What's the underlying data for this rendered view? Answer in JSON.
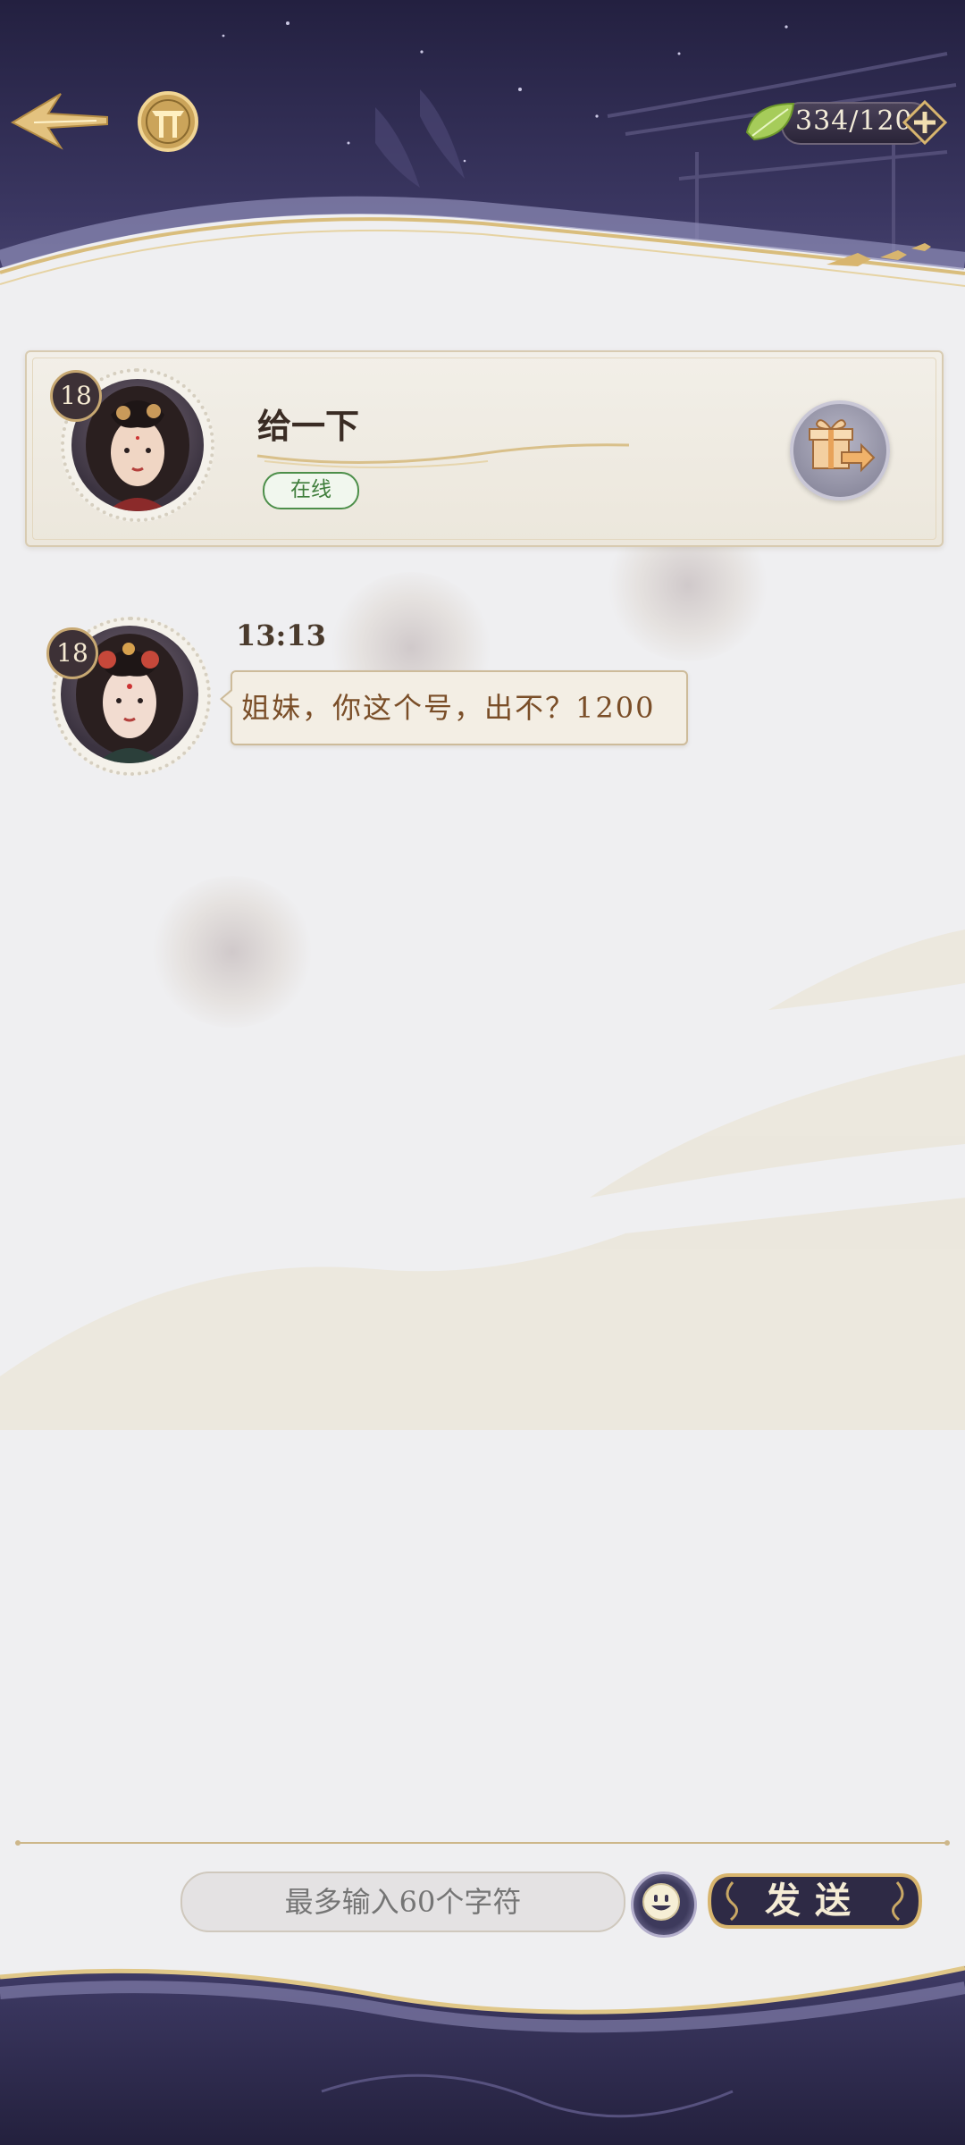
{
  "header": {
    "back_icon": "back-arrow-icon",
    "menu_icon": "gate-menu-icon",
    "currency": {
      "icon": "leaf-icon",
      "value": "334/120",
      "plus_icon": "plus-icon"
    }
  },
  "contact": {
    "level": "18",
    "name": "给一下",
    "status": "在线",
    "gift_icon": "gift-send-icon"
  },
  "messages": [
    {
      "level": "18",
      "time": "13:13",
      "text": "姐妹，你这个号，出不？1200"
    }
  ],
  "composer": {
    "placeholder": "最多输入60个字符",
    "emoji_icon": "emoji-icon",
    "send_label": "发送"
  },
  "colors": {
    "header_bg": "#2b2647",
    "accent_gold": "#d8b56e",
    "online_green": "#3e7d3a",
    "message_text": "#7a4e28"
  }
}
